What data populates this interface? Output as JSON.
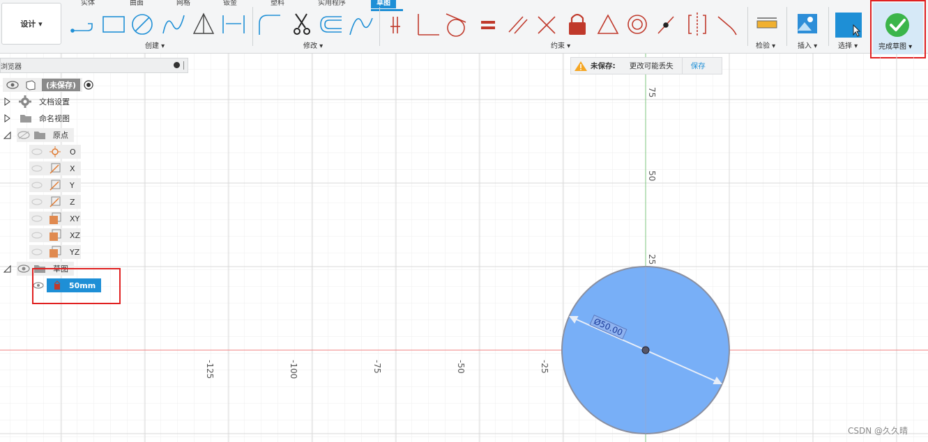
{
  "tabs": [
    "实体",
    "曲面",
    "网格",
    "钣金",
    "塑料",
    "实用程序",
    "草图"
  ],
  "active_tab": "草图",
  "design_button": "设计 ▾",
  "groups": {
    "create": "创建 ▾",
    "modify": "修改 ▾",
    "constraints": "约束 ▾",
    "inspect": "检验 ▾",
    "insert": "插入 ▾",
    "select": "选择 ▾",
    "finish": "完成草图 ▾"
  },
  "browser": {
    "title": "浏览器",
    "root": "(未保存)",
    "items": {
      "doc_settings": "文档设置",
      "named_views": "命名视图",
      "origin": "原点",
      "o": "O",
      "x": "X",
      "y": "Y",
      "z": "Z",
      "xy": "XY",
      "xz": "XZ",
      "yz": "YZ",
      "sketches": "草图",
      "sketch1": "50mm"
    }
  },
  "warning": {
    "title": "未保存:",
    "message": "更改可能丢失",
    "save": "保存"
  },
  "axis": {
    "x_ticks": [
      "-125",
      "-100",
      "-75",
      "-50",
      "-25"
    ],
    "y_ticks": [
      "75",
      "50",
      "25"
    ]
  },
  "dimension_label": "Ø50.00",
  "watermark": "CSDN @久久晴",
  "colors": {
    "accent": "#1e8fd6",
    "circle_fill": "#78aff7",
    "highlight_red": "#e02020",
    "finish_green": "#3bb54a"
  }
}
